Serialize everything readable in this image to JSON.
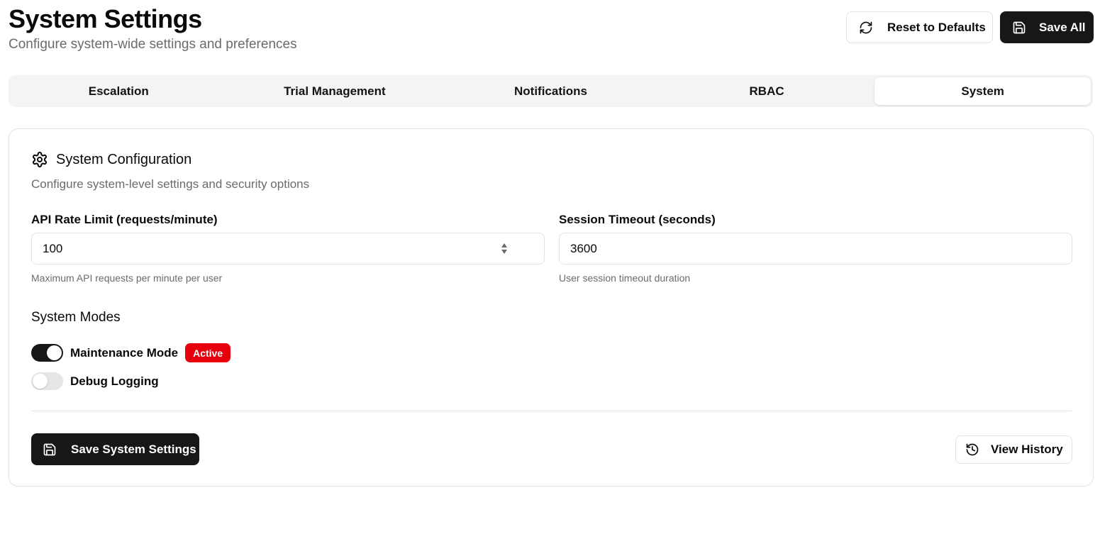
{
  "header": {
    "title": "System Settings",
    "subtitle": "Configure system-wide settings and preferences",
    "reset_label": "Reset to Defaults",
    "save_all_label": "Save All"
  },
  "tabs": [
    {
      "label": "Escalation",
      "active": false
    },
    {
      "label": "Trial Management",
      "active": false
    },
    {
      "label": "Notifications",
      "active": false
    },
    {
      "label": "RBAC",
      "active": false
    },
    {
      "label": "System",
      "active": true
    }
  ],
  "card": {
    "title": "System Configuration",
    "description": "Configure system-level settings and security options",
    "fields": {
      "api_rate_limit": {
        "label": "API Rate Limit (requests/minute)",
        "value": "100",
        "help": "Maximum API requests per minute per user"
      },
      "session_timeout": {
        "label": "Session Timeout (seconds)",
        "value": "3600",
        "help": "User session timeout duration"
      }
    },
    "modes": {
      "title": "System Modes",
      "maintenance": {
        "label": "Maintenance Mode",
        "enabled": true,
        "badge": "Active"
      },
      "debug": {
        "label": "Debug Logging",
        "enabled": false
      }
    },
    "save_label": "Save System Settings",
    "history_label": "View History"
  },
  "colors": {
    "primary_dark": "#171717",
    "badge_red": "#e7000b",
    "muted_text": "#6b6b6b",
    "border": "#e3e3e3"
  },
  "icons": {
    "reset": "refresh-icon",
    "save": "floppy-disk-icon",
    "settings": "gear-icon",
    "history": "history-icon"
  }
}
